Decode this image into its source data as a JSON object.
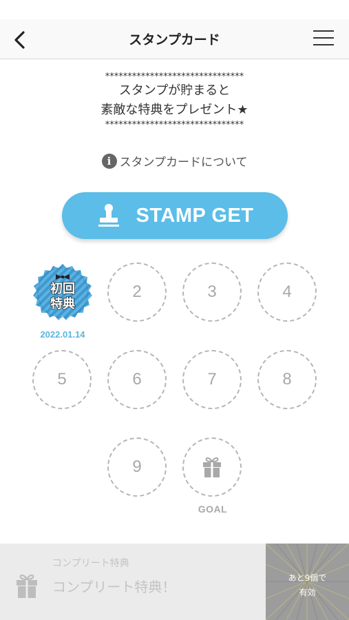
{
  "header": {
    "title": "スタンプカード",
    "back_icon": "chevron-left-icon",
    "menu_icon": "hamburger-menu-icon"
  },
  "intro": {
    "stars_top": "*******************************",
    "line1": "スタンプが貯まると",
    "line2": "素敵な特典をプレゼント★",
    "stars_bottom": "*******************************"
  },
  "about": {
    "icon": "info-icon",
    "icon_glyph": "i",
    "label": "スタンプカードについて"
  },
  "stamp_button": {
    "icon": "stamp-icon",
    "label": "STAMP GET",
    "color": "#5bbde8"
  },
  "stamps": {
    "first": {
      "text_line1": "初回",
      "text_line2": "特典",
      "date": "2022.01.14"
    },
    "slots": [
      "2",
      "3",
      "4",
      "5",
      "6",
      "7",
      "8",
      "9"
    ],
    "goal_icon": "gift-icon",
    "goal_label": "GOAL"
  },
  "complete": {
    "icon": "gift-icon",
    "sub_label": "コンプリート特典",
    "main_label": "コンプリート特典！",
    "remaining_line1": "あと9個で",
    "remaining_line2": "有効"
  },
  "colors": {
    "accent": "#5bbde8",
    "date": "#5bb4e0",
    "slot_border": "#b5b5b5",
    "disabled_text": "#c4c4c4"
  }
}
